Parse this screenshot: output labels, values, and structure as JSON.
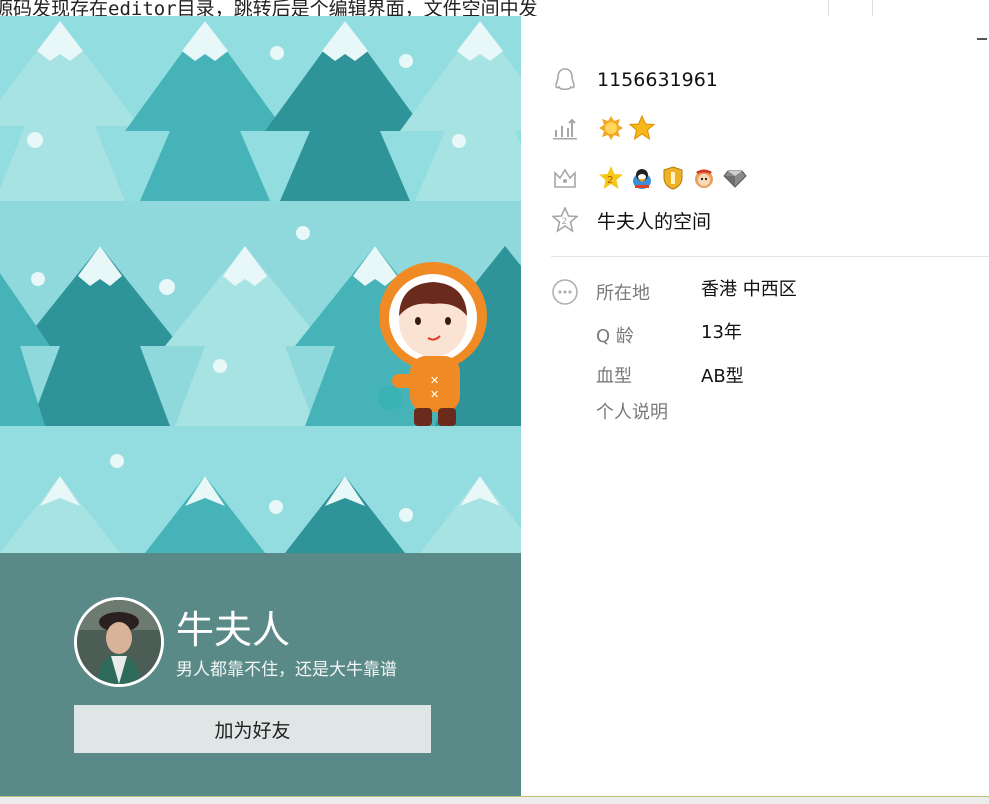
{
  "background_window": {
    "text": "源码发现存在editor目录，跳转后是个编辑界面，文件空间中发"
  },
  "profile": {
    "nickname": "牛夫人",
    "signature": "男人都靠不住，还是大牛靠谱",
    "add_friend_label": "加为好友"
  },
  "details": {
    "qq_number": "1156631961",
    "space_label": "牛夫人的空间",
    "level_icons": [
      "sun-level-icon",
      "star-level-icon"
    ],
    "vip_icons": [
      "star-vip-icon",
      "penguin-vip-icon",
      "shield-vip-icon",
      "monkey-vip-icon",
      "diamond-vip-icon"
    ],
    "fields": [
      {
        "label": "所在地",
        "value": "香港 中西区"
      },
      {
        "label": "Q 龄",
        "value": "13年"
      },
      {
        "label": "血型",
        "value": "AB型"
      },
      {
        "label": "个人说明",
        "value": ""
      }
    ]
  },
  "colors": {
    "sky": "#92dde0",
    "footer": "#5a8a88",
    "accent_orange": "#f08a24"
  }
}
